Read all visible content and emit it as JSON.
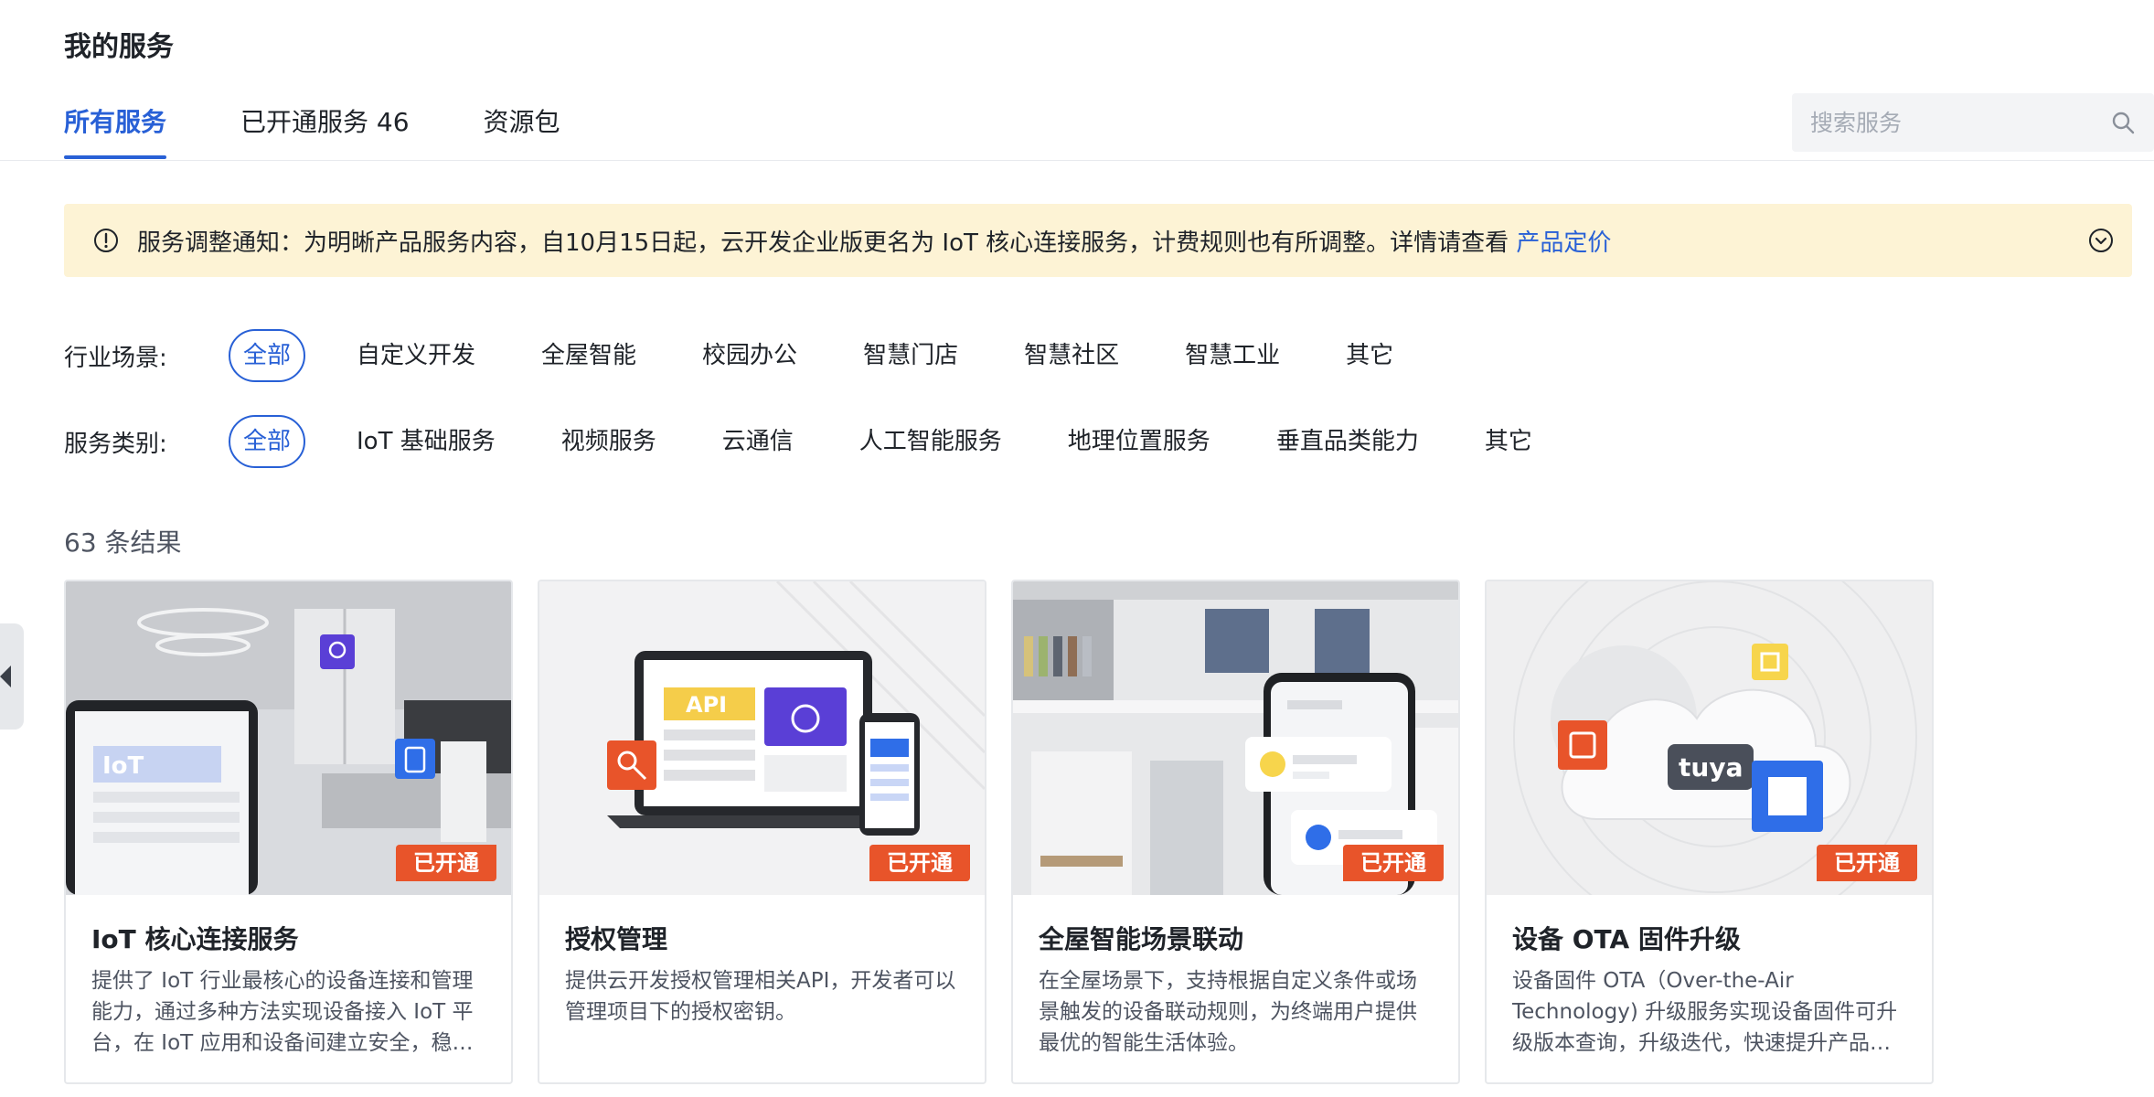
{
  "page": {
    "title": "我的服务"
  },
  "tabs": [
    {
      "label": "所有服务",
      "active": true
    },
    {
      "label": "已开通服务 46",
      "active": false
    },
    {
      "label": "资源包",
      "active": false
    }
  ],
  "search": {
    "placeholder": "搜索服务",
    "icon": "search-icon"
  },
  "notice": {
    "text": "服务调整通知：为明晰产品服务内容，自10月15日起，云开发企业版更名为 IoT 核心连接服务，计费规则也有所调整。详情请查看 ",
    "link_label": "产品定价",
    "icon": "info-circle-icon",
    "expand_icon": "chevron-down-circle-icon",
    "background": "#fdf3d5"
  },
  "filters": {
    "industry": {
      "label": "行业场景:",
      "options": [
        "全部",
        "自定义开发",
        "全屋智能",
        "校园办公",
        "智慧门店",
        "智慧社区",
        "智慧工业",
        "其它"
      ],
      "selected": "全部"
    },
    "category": {
      "label": "服务类别:",
      "options": [
        "全部",
        "IoT 基础服务",
        "视频服务",
        "云通信",
        "人工智能服务",
        "地理位置服务",
        "垂直品类能力",
        "其它"
      ],
      "selected": "全部"
    }
  },
  "results": {
    "count_label": "63 条结果"
  },
  "cards": [
    {
      "title": "IoT 核心连接服务",
      "desc": "提供了 IoT 行业最核心的设备连接和管理能力，通过多种方法实现设备接入 IoT 平台，在 IoT 应用和设备间建立安全，稳定的双向通信。",
      "badge": "已开通",
      "image_text": "IoT"
    },
    {
      "title": "授权管理",
      "desc": "提供云开发授权管理相关API，开发者可以管理项目下的授权密钥。",
      "badge": "已开通",
      "image_text": "API"
    },
    {
      "title": "全屋智能场景联动",
      "desc": "在全屋场景下，支持根据自定义条件或场景触发的设备联动规则，为终端用户提供最优的智能生活体验。",
      "badge": "已开通"
    },
    {
      "title": "设备 OTA 固件升级",
      "desc": "设备固件 OTA（Over-the-Air Technology) 升级服务实现设备固件可升级版本查询，升级迭代，快速提升产品体验。",
      "badge": "已开通",
      "image_text": "tuya"
    }
  ],
  "colors": {
    "accent": "#2860d6",
    "badge": "#e8542a",
    "notice_bg": "#fdf3d5"
  }
}
